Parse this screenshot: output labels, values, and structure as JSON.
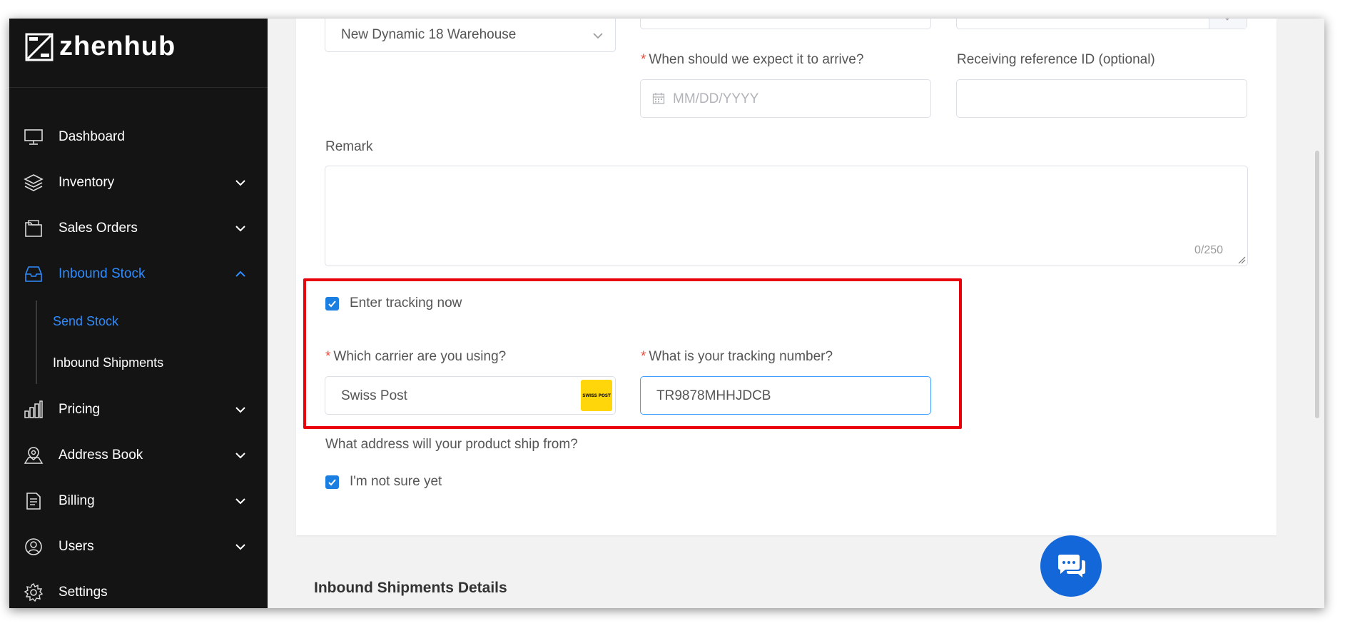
{
  "app": {
    "logo_text": "zhenhub"
  },
  "sidebar": {
    "items": [
      {
        "label": "Dashboard",
        "icon": "monitor-icon"
      },
      {
        "label": "Inventory",
        "icon": "layers-icon"
      },
      {
        "label": "Sales Orders",
        "icon": "folder-icon"
      },
      {
        "label": "Inbound Stock",
        "icon": "inbox-icon",
        "active": true
      },
      {
        "label": "Pricing",
        "icon": "bar-chart-icon"
      },
      {
        "label": "Address Book",
        "icon": "map-pin-icon"
      },
      {
        "label": "Billing",
        "icon": "document-icon"
      },
      {
        "label": "Users",
        "icon": "user-icon"
      },
      {
        "label": "Settings",
        "icon": "gear-icon"
      }
    ],
    "sub_items": [
      {
        "label": "Send Stock",
        "active": true
      },
      {
        "label": "Inbound Shipments"
      }
    ]
  },
  "form": {
    "warehouse": {
      "value": "New Dynamic 18 Warehouse"
    },
    "arrival": {
      "label": "When should we expect it to arrive?",
      "placeholder": "MM/DD/YYYY"
    },
    "reference": {
      "label": "Receiving reference ID (optional)",
      "value": ""
    },
    "remark": {
      "label": "Remark",
      "value": "",
      "counter": "0/250"
    },
    "tracking_toggle": {
      "label": "Enter tracking now",
      "checked": true
    },
    "carrier": {
      "label": "Which carrier are you using?",
      "value": "Swiss Post",
      "logo_text": "SWISS POST"
    },
    "tracking_number": {
      "label": "What is your tracking number?",
      "value": "TR9878MHHJDCB"
    },
    "ship_from": {
      "label": "What address will your product ship from?"
    },
    "not_sure": {
      "label": "I'm not sure yet",
      "checked": true
    }
  },
  "section": {
    "title": "Inbound Shipments Details"
  },
  "colors": {
    "accent": "#2f8cff",
    "sidebar_bg": "#141414",
    "highlight": "#e8000b",
    "chat": "#1467d9",
    "checkbox": "#1a7fe0"
  }
}
